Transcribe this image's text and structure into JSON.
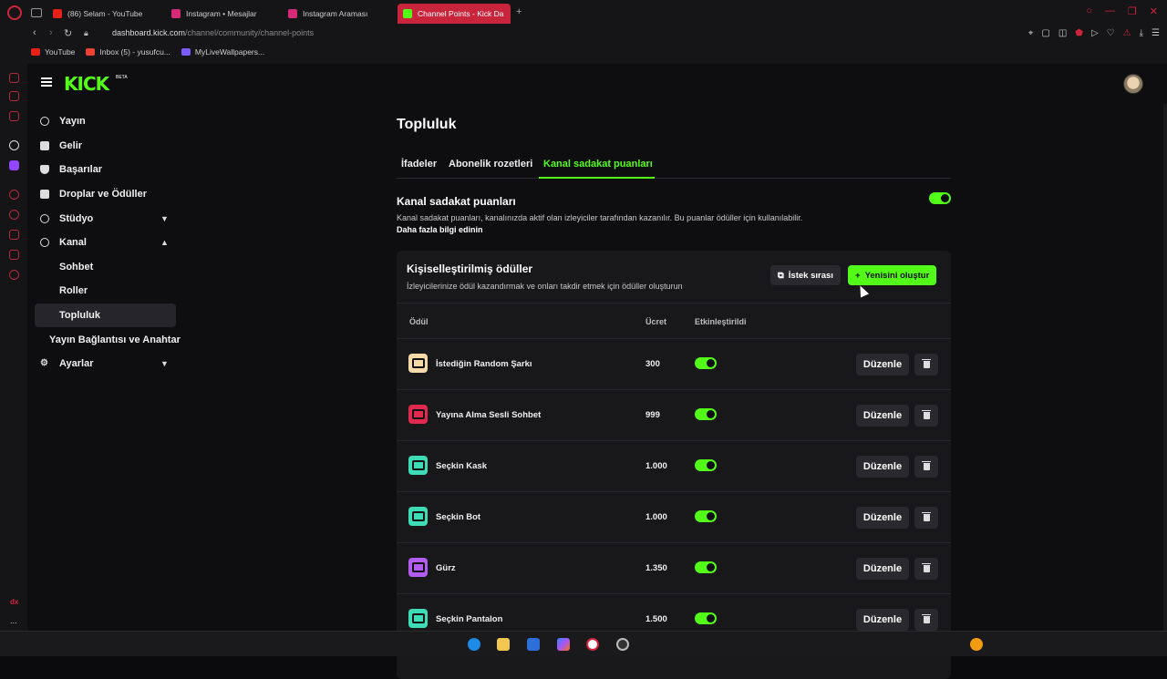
{
  "browser": {
    "tabs": [
      {
        "label": "(86) Selam - YouTube",
        "color": "#e62117"
      },
      {
        "label": "Instagram • Mesajlar",
        "color": "#d62976"
      },
      {
        "label": "Instagram Araması",
        "color": "#d62976"
      },
      {
        "label": "Channel Points - Kick Da",
        "color": "#53fc18"
      }
    ],
    "url_host": "dashboard.kick.com",
    "url_path": "/channel/community/channel-points",
    "bookmarks": [
      {
        "label": "YouTube",
        "color": "#e62117"
      },
      {
        "label": "Inbox (5) - yusufcu...",
        "color": "#ea4335"
      },
      {
        "label": "MyLiveWallpapers...",
        "color": "#7a5cff"
      }
    ]
  },
  "app": {
    "logo": "KICK",
    "logo_badge": "BETA",
    "accent": "#53fc18"
  },
  "sidebar": {
    "items": [
      {
        "label": "Yayın"
      },
      {
        "label": "Gelir"
      },
      {
        "label": "Başarılar"
      },
      {
        "label": "Droplar ve Ödüller"
      },
      {
        "label": "Stüdyo"
      },
      {
        "label": "Kanal"
      },
      {
        "label": "Sohbet"
      },
      {
        "label": "Roller"
      },
      {
        "label": "Topluluk"
      },
      {
        "label": "Yayın Bağlantısı ve Anahtar"
      },
      {
        "label": "Ayarlar"
      }
    ]
  },
  "main": {
    "title": "Topluluk",
    "tabs": [
      {
        "label": "İfadeler"
      },
      {
        "label": "Abonelik rozetleri"
      },
      {
        "label": "Kanal sadakat puanları"
      }
    ],
    "section_title": "Kanal sadakat puanları",
    "section_desc": "Kanal sadakat puanları, kanalınızda aktif olan izleyiciler tarafından kazanılır. Bu puanlar ödüller için kullanılabilir.",
    "learn_more": "Daha fazla bilgi edinin",
    "enabled": true
  },
  "rewards": {
    "title": "Kişiselleştirilmiş ödüller",
    "desc": "İzleyicilerinize ödül kazandırmak ve onları takdir etmek için ödüller oluşturun",
    "queue_button": "İstek sırası",
    "new_button": "Yenisini oluştur",
    "headers": {
      "reward": "Ödül",
      "cost": "Ücret",
      "enabled": "Etkinleştirildi"
    },
    "edit_label": "Düzenle",
    "rows": [
      {
        "name": "İstediğin Random Şarkı",
        "cost": "300",
        "color": "#f5d9a8",
        "enabled": true
      },
      {
        "name": "Yayına Alma Sesli Sohbet",
        "cost": "999",
        "color": "#e0294f",
        "enabled": true
      },
      {
        "name": "Seçkin Kask",
        "cost": "1.000",
        "color": "#3ddbb6",
        "enabled": true
      },
      {
        "name": "Seçkin Bot",
        "cost": "1.000",
        "color": "#3ddbb6",
        "enabled": true
      },
      {
        "name": "Gürz",
        "cost": "1.350",
        "color": "#b25cf0",
        "enabled": true
      },
      {
        "name": "Seçkin Pantalon",
        "cost": "1.500",
        "color": "#3ddbb6",
        "enabled": true
      }
    ]
  },
  "os": {
    "corner_label": "dx",
    "more_label": "..."
  }
}
